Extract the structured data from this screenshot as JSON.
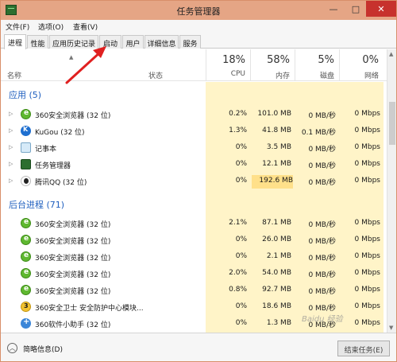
{
  "window": {
    "title": "任务管理器",
    "minimize": "—",
    "maximize": "□",
    "close": "✕"
  },
  "menu": [
    "文件(F)",
    "选项(O)",
    "查看(V)"
  ],
  "tabs": [
    "进程",
    "性能",
    "应用历史记录",
    "启动",
    "用户",
    "详细信息",
    "服务"
  ],
  "columns": {
    "name": "名称",
    "status": "状态",
    "cpu": {
      "pct": "18%",
      "label": "CPU"
    },
    "memory": {
      "pct": "58%",
      "label": "内存"
    },
    "disk": {
      "pct": "5%",
      "label": "磁盘"
    },
    "network": {
      "pct": "0%",
      "label": "网络"
    }
  },
  "groups": {
    "apps": "应用 (5)",
    "background": "后台进程 (71)"
  },
  "apps": [
    {
      "name": "360安全浏览器 (32 位)",
      "cpu": "0.2%",
      "mem": "101.0 MB",
      "disk": "0 MB/秒",
      "net": "0 Mbps",
      "icon": "browser-360-icon"
    },
    {
      "name": "KuGou (32 位)",
      "cpu": "1.3%",
      "mem": "41.8 MB",
      "disk": "0.1 MB/秒",
      "net": "0 Mbps",
      "icon": "kugou-icon"
    },
    {
      "name": "记事本",
      "cpu": "0%",
      "mem": "3.5 MB",
      "disk": "0 MB/秒",
      "net": "0 Mbps",
      "icon": "notepad-icon"
    },
    {
      "name": "任务管理器",
      "cpu": "0%",
      "mem": "12.1 MB",
      "disk": "0 MB/秒",
      "net": "0 Mbps",
      "icon": "task-manager-icon"
    },
    {
      "name": "腾讯QQ (32 位)",
      "cpu": "0%",
      "mem": "192.6 MB",
      "disk": "0 MB/秒",
      "net": "0 Mbps",
      "icon": "qq-icon"
    }
  ],
  "background": [
    {
      "name": "360安全浏览器 (32 位)",
      "cpu": "2.1%",
      "mem": "87.1 MB",
      "disk": "0 MB/秒",
      "net": "0 Mbps",
      "icon": "browser-360-icon"
    },
    {
      "name": "360安全浏览器 (32 位)",
      "cpu": "0%",
      "mem": "26.0 MB",
      "disk": "0 MB/秒",
      "net": "0 Mbps",
      "icon": "browser-360-icon"
    },
    {
      "name": "360安全浏览器 (32 位)",
      "cpu": "0%",
      "mem": "2.1 MB",
      "disk": "0 MB/秒",
      "net": "0 Mbps",
      "icon": "browser-360-icon"
    },
    {
      "name": "360安全浏览器 (32 位)",
      "cpu": "2.0%",
      "mem": "54.0 MB",
      "disk": "0 MB/秒",
      "net": "0 Mbps",
      "icon": "browser-360-icon"
    },
    {
      "name": "360安全浏览器 (32 位)",
      "cpu": "0.8%",
      "mem": "92.7 MB",
      "disk": "0 MB/秒",
      "net": "0 Mbps",
      "icon": "browser-360-icon"
    },
    {
      "name": "360安全卫士 安全防护中心模块...",
      "cpu": "0%",
      "mem": "18.6 MB",
      "disk": "0 MB/秒",
      "net": "0 Mbps",
      "icon": "360-safe-icon"
    },
    {
      "name": "360软件小助手 (32 位)",
      "cpu": "0%",
      "mem": "1.3 MB",
      "disk": "0 MB/秒",
      "net": "0 Mbps",
      "icon": "360-soft-icon"
    }
  ],
  "footer": {
    "brief": "简略信息(D)",
    "end_task": "结束任务(E)"
  },
  "watermark": "Baidu 经验"
}
